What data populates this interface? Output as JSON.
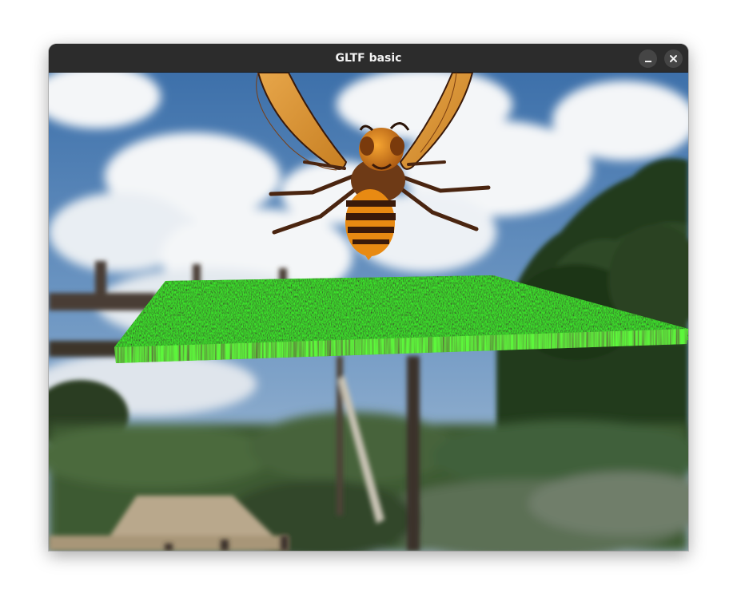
{
  "window": {
    "title": "GLTF basic",
    "controls": {
      "minimize_icon": "minimize-icon",
      "close_icon": "close-icon"
    }
  },
  "scene": {
    "background": "park-photo",
    "model": "hornet",
    "ground": "grass-textured-slab"
  },
  "colors": {
    "titlebar": "#2c2c2c",
    "title_text": "#f2f2f2",
    "sky": "#4f7fb4",
    "grass": "#2fae22",
    "hornet_orange": "#e88a12",
    "hornet_dark": "#3a1a0a"
  }
}
